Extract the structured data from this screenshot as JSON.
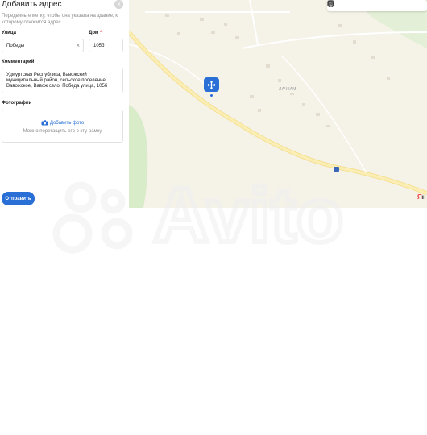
{
  "form": {
    "title": "Добавить адрес",
    "close_glyph": "×",
    "hint": "Передвиньте метку, чтобы она указала на здание, к которому относится адрес",
    "street": {
      "label": "Улица",
      "value": "Победы",
      "clear_glyph": "×"
    },
    "house": {
      "label": "Дом",
      "required_mark": "*",
      "value": "105б"
    },
    "comment": {
      "label": "Комментарий",
      "value": "Удмуртская Республика, Вавожский муниципальный район, сельское поселение Вавожское, Вавож село, Победа улица, 105б"
    },
    "photos": {
      "label": "Фотографии",
      "add_label": "Добавить фото",
      "drop_hint": "Можно перетащить его в эту рамку"
    },
    "submit_label": "Отправить"
  },
  "map": {
    "village_label": "ЛАЧКАМ",
    "logo": {
      "ya": "Я",
      "rest": "н"
    },
    "toolbar_icons": [
      "traffic-icon",
      "panorama-icon",
      "transport-icon",
      "bus-icon",
      "ruler-icon"
    ]
  },
  "colors": {
    "accent": "#2a6fd6",
    "map_background": "#f5f2e8",
    "road": "#f7e9a8",
    "forest": "#d8ecc9",
    "required": "#e53935"
  },
  "watermark_text": "Avito"
}
